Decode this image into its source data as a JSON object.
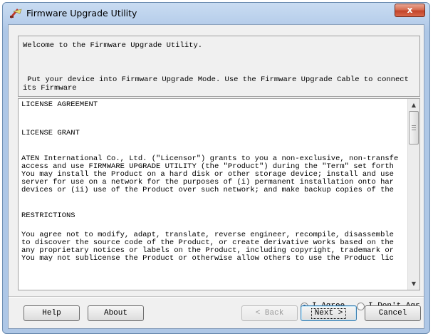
{
  "window": {
    "title": "Firmware Upgrade Utility",
    "close_label": "x",
    "app_icon": "firmware-upgrade-app-icon"
  },
  "welcome": {
    "line1": "Welcome to the Firmware Upgrade Utility.",
    "line2": " Put your device into Firmware Upgrade Mode. Use the Firmware Upgrade Cable to connect",
    "line3": "its Firmware"
  },
  "license": {
    "heading": "LICENSE AGREEMENT",
    "grant_heading": "LICENSE GRANT",
    "grant_lines": [
      "ATEN International Co., Ltd. (\"Licensor\") grants to you a non-exclusive, non-transfe",
      "access and use FIRMWARE UPGRADE UTILITY (the \"Product\") during the \"Term\" set forth",
      "You may install the Product on a hard disk or other storage device; install and use",
      "server for use on a network for the purposes of (i) permanent installation onto har",
      "devices or (ii) use of the Product over such network; and make backup copies of the"
    ],
    "restrictions_heading": "RESTRICTIONS",
    "restrictions_lines": [
      "You agree not to modify, adapt, translate, reverse engineer, recompile, disassemble",
      "to discover the source code of the Product, or create derivative works based on the",
      "any proprietary notices or labels on the Product, including copyright, trademark or",
      "You may not sublicense the Product or otherwise allow others to use the Product lic"
    ]
  },
  "agreement": {
    "agree_label": "I Agree",
    "disagree_label": "I Don't Agr",
    "selected": "agree"
  },
  "buttons": {
    "help": "Help",
    "about": "About",
    "back": "< Back",
    "next": "Next >",
    "cancel": "Cancel"
  },
  "colors": {
    "title_bar": "#b6cdea",
    "close_button": "#c3442a",
    "dialog_bg": "#f0f0f0",
    "default_button_border": "#3c7fb1"
  }
}
